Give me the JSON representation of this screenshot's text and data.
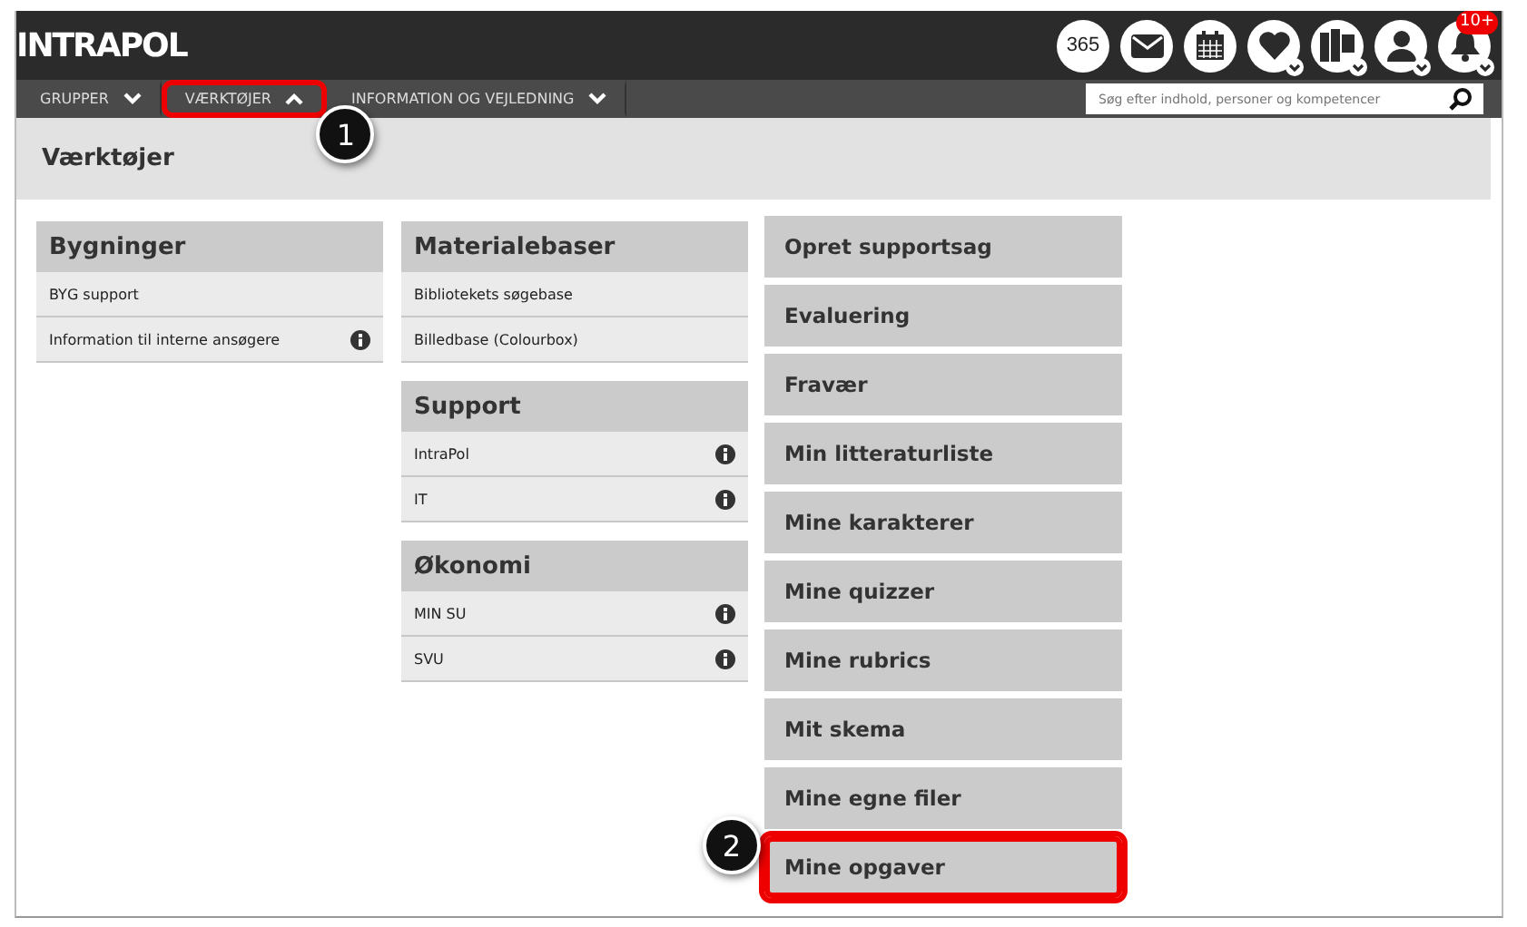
{
  "header": {
    "logo": "INTRAPOL",
    "icons": [
      {
        "kind": "office",
        "label": "365"
      },
      {
        "kind": "mail"
      },
      {
        "kind": "calendar"
      },
      {
        "kind": "heart",
        "dropdown": true
      },
      {
        "kind": "books",
        "dropdown": true
      },
      {
        "kind": "person",
        "dropdown": true
      },
      {
        "kind": "bell",
        "dropdown": true,
        "badge": "10+"
      }
    ]
  },
  "nav": {
    "items": [
      {
        "label": "GRUPPER",
        "expanded": false,
        "highlighted": false
      },
      {
        "label": "VÆRKTØJER",
        "expanded": true,
        "highlighted": true,
        "callout": "1"
      },
      {
        "label": "INFORMATION OG VEJLEDNING",
        "expanded": false,
        "highlighted": false
      }
    ],
    "search": {
      "placeholder": "Søg efter indhold, personer og kompetencer"
    }
  },
  "page_title": "Værktøjer",
  "columns": [
    {
      "groups": [
        {
          "title": "Bygninger",
          "rows": [
            {
              "label": "BYG support",
              "info": false
            },
            {
              "label": "Information til interne ansøgere",
              "info": true
            }
          ]
        }
      ]
    },
    {
      "groups": [
        {
          "title": "Materialebaser",
          "rows": [
            {
              "label": "Bibliotekets søgebase",
              "info": false
            },
            {
              "label": "Billedbase (Colourbox)",
              "info": false
            }
          ]
        },
        {
          "title": "Support",
          "rows": [
            {
              "label": "IntraPol",
              "info": true
            },
            {
              "label": "IT",
              "info": true
            }
          ]
        },
        {
          "title": "Økonomi",
          "rows": [
            {
              "label": "MIN SU",
              "info": true
            },
            {
              "label": "SVU",
              "info": true
            }
          ]
        }
      ]
    }
  ],
  "tools": [
    {
      "label": "Opret supportsag",
      "highlighted": false
    },
    {
      "label": "Evaluering",
      "highlighted": false
    },
    {
      "label": "Fravær",
      "highlighted": false
    },
    {
      "label": "Min litteraturliste",
      "highlighted": false
    },
    {
      "label": "Mine karakterer",
      "highlighted": false
    },
    {
      "label": "Mine quizzer",
      "highlighted": false
    },
    {
      "label": "Mine rubrics",
      "highlighted": false
    },
    {
      "label": "Mit skema",
      "highlighted": false
    },
    {
      "label": "Mine egne filer",
      "highlighted": false
    },
    {
      "label": "Mine opgaver",
      "highlighted": true,
      "callout": "2"
    }
  ]
}
